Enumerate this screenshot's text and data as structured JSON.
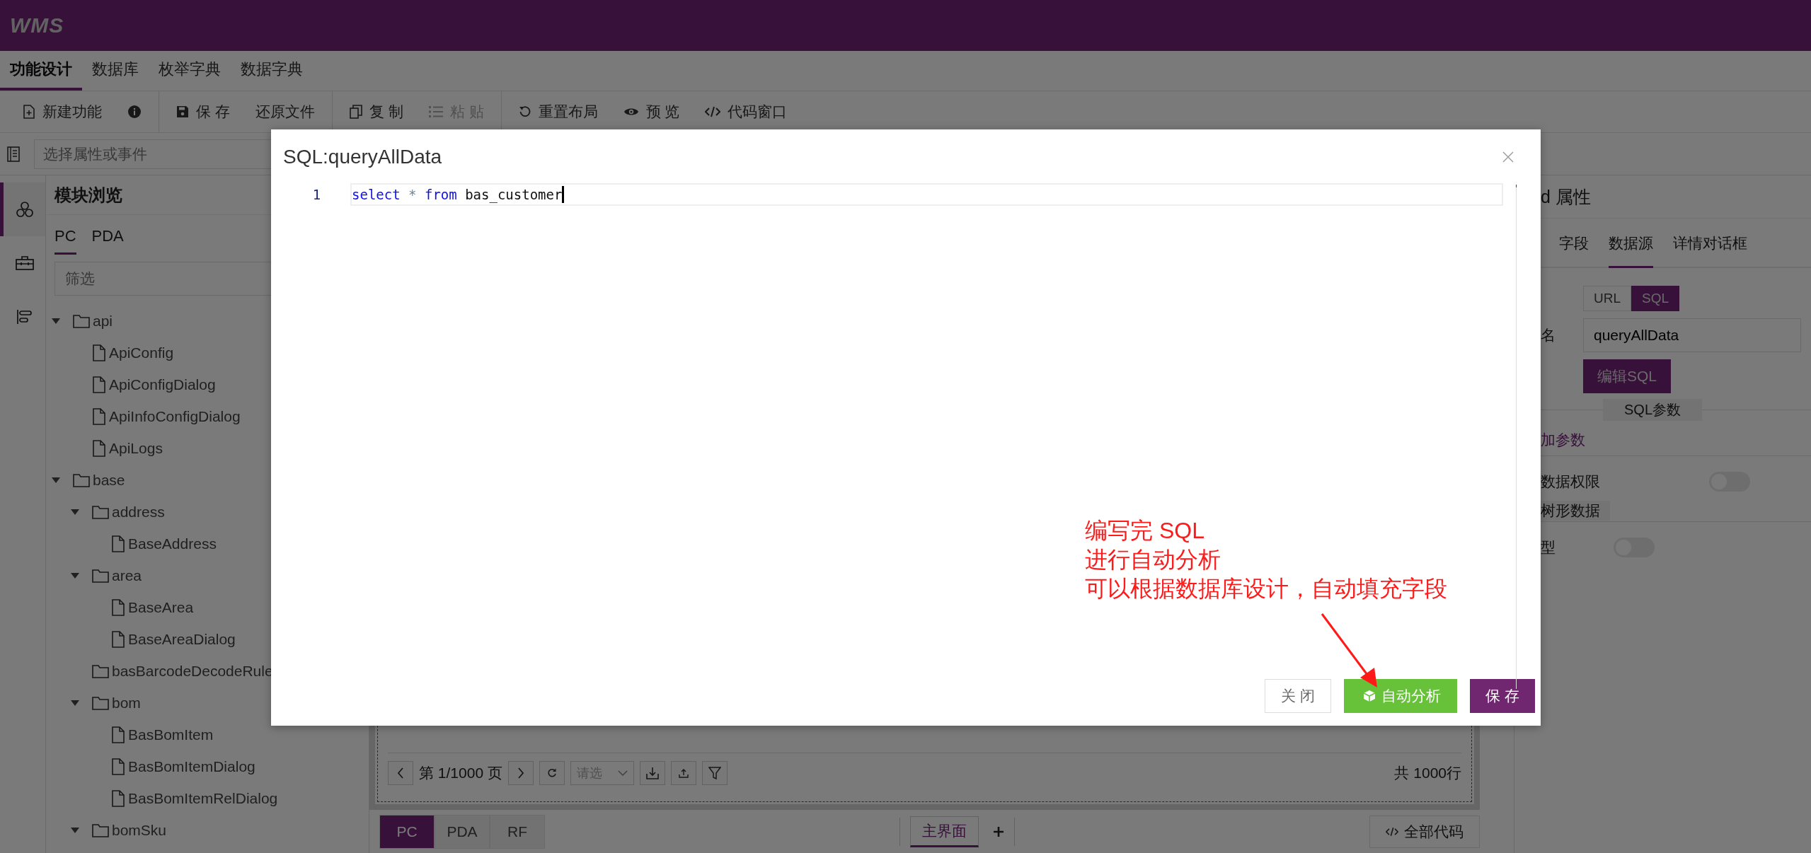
{
  "app": {
    "logo": "WMS"
  },
  "main_tabs": [
    {
      "label": "功能设计",
      "selected": true
    },
    {
      "label": "数据库",
      "selected": false
    },
    {
      "label": "枚举字典",
      "selected": false
    },
    {
      "label": "数据字典",
      "selected": false
    }
  ],
  "toolbar": [
    {
      "items": [
        {
          "kind": "new",
          "label": "新建功能",
          "disabled": false
        },
        {
          "kind": "info",
          "disabled": false
        }
      ]
    },
    {
      "items": [
        {
          "kind": "save",
          "label": "保 存",
          "disabled": false
        },
        {
          "kind": "restore",
          "label": "还原文件",
          "disabled": false
        }
      ]
    },
    {
      "items": [
        {
          "kind": "copy",
          "label": "复 制",
          "disabled": false
        },
        {
          "kind": "paste",
          "label": "粘 贴",
          "disabled": true
        }
      ]
    },
    {
      "items": [
        {
          "kind": "reset",
          "label": "重置布局",
          "disabled": false
        },
        {
          "kind": "preview",
          "label": "预 览",
          "disabled": false
        },
        {
          "kind": "code",
          "label": "代码窗口",
          "disabled": false
        }
      ]
    }
  ],
  "property_select": {
    "placeholder": "选择属性或事件"
  },
  "rail": [
    {
      "kind": "modules",
      "selected": true
    },
    {
      "kind": "toolbox",
      "selected": false
    },
    {
      "kind": "layers",
      "selected": false
    }
  ],
  "sidebar": {
    "title": "模块浏览",
    "tabs": [
      {
        "label": "PC",
        "selected": true
      },
      {
        "label": "PDA",
        "selected": false
      }
    ],
    "filter": {
      "placeholder": "筛选"
    },
    "tree": [
      {
        "name": "api",
        "kind": "folder",
        "expanded": true,
        "children": [
          {
            "name": "ApiConfig",
            "kind": "file"
          },
          {
            "name": "ApiConfigDialog",
            "kind": "file"
          },
          {
            "name": "ApiInfoConfigDialog",
            "kind": "file"
          },
          {
            "name": "ApiLogs",
            "kind": "file"
          }
        ]
      },
      {
        "name": "base",
        "kind": "folder",
        "expanded": true,
        "children": [
          {
            "name": "address",
            "kind": "folder",
            "expanded": true,
            "children": [
              {
                "name": "BaseAddress",
                "kind": "file"
              }
            ]
          },
          {
            "name": "area",
            "kind": "folder",
            "expanded": true,
            "children": [
              {
                "name": "BaseArea",
                "kind": "file"
              },
              {
                "name": "BaseAreaDialog",
                "kind": "file"
              }
            ]
          },
          {
            "name": "basBarcodeDecodeRule",
            "kind": "empty-folder"
          },
          {
            "name": "bom",
            "kind": "folder",
            "expanded": true,
            "children": [
              {
                "name": "BasBomItem",
                "kind": "file"
              },
              {
                "name": "BasBomItemDialog",
                "kind": "file"
              },
              {
                "name": "BasBomItemRelDialog",
                "kind": "file"
              }
            ]
          },
          {
            "name": "bomSku",
            "kind": "folder",
            "expanded": true
          }
        ]
      }
    ]
  },
  "canvas": {
    "pager": {
      "page": "第 1/1000 页",
      "page_size_placeholder": "请选",
      "total": "共 1000行"
    },
    "device_tabs": [
      {
        "label": "PC",
        "selected": true
      },
      {
        "label": "PDA",
        "selected": false
      },
      {
        "label": "RF",
        "selected": false
      }
    ],
    "view_tabs": [
      {
        "label": "主界面",
        "selected": true
      }
    ],
    "code_button": "全部代码"
  },
  "properties": {
    "title": "d 属性",
    "tabs": [
      {
        "label": "字段",
        "selected": false
      },
      {
        "label": "数据源",
        "selected": true
      },
      {
        "label": "详情对话框",
        "selected": false
      }
    ],
    "source_toggle": [
      {
        "label": "URL",
        "selected": false
      },
      {
        "label": "SQL",
        "selected": true
      }
    ],
    "name_label": "名",
    "name_value": "queryAllData",
    "edit_button": "编辑SQL",
    "params_title": "SQL参数",
    "add_param": "加参数",
    "switch_1": {
      "label": "数据权限",
      "on": false
    },
    "note": "树形数据",
    "switch_2": {
      "label": "型",
      "on": false
    }
  },
  "dialog": {
    "title": "SQL:queryAllData",
    "editor": {
      "lines": [
        {
          "number": "1",
          "tokens": [
            {
              "text": "select",
              "kind": "keyword"
            },
            {
              "text": " * ",
              "kind": "operator"
            },
            {
              "text": "from",
              "kind": "keyword"
            },
            {
              "text": " bas_customer",
              "kind": "plain"
            }
          ]
        }
      ]
    },
    "buttons": [
      {
        "label": "关 闭",
        "kind": "default"
      },
      {
        "label": "自动分析",
        "kind": "success"
      },
      {
        "label": "保 存",
        "kind": "primary"
      }
    ]
  },
  "annotation": {
    "lines": [
      "编写完 SQL",
      "进行自动分析",
      "可以根据数据库设计，自动填充字段"
    ]
  }
}
